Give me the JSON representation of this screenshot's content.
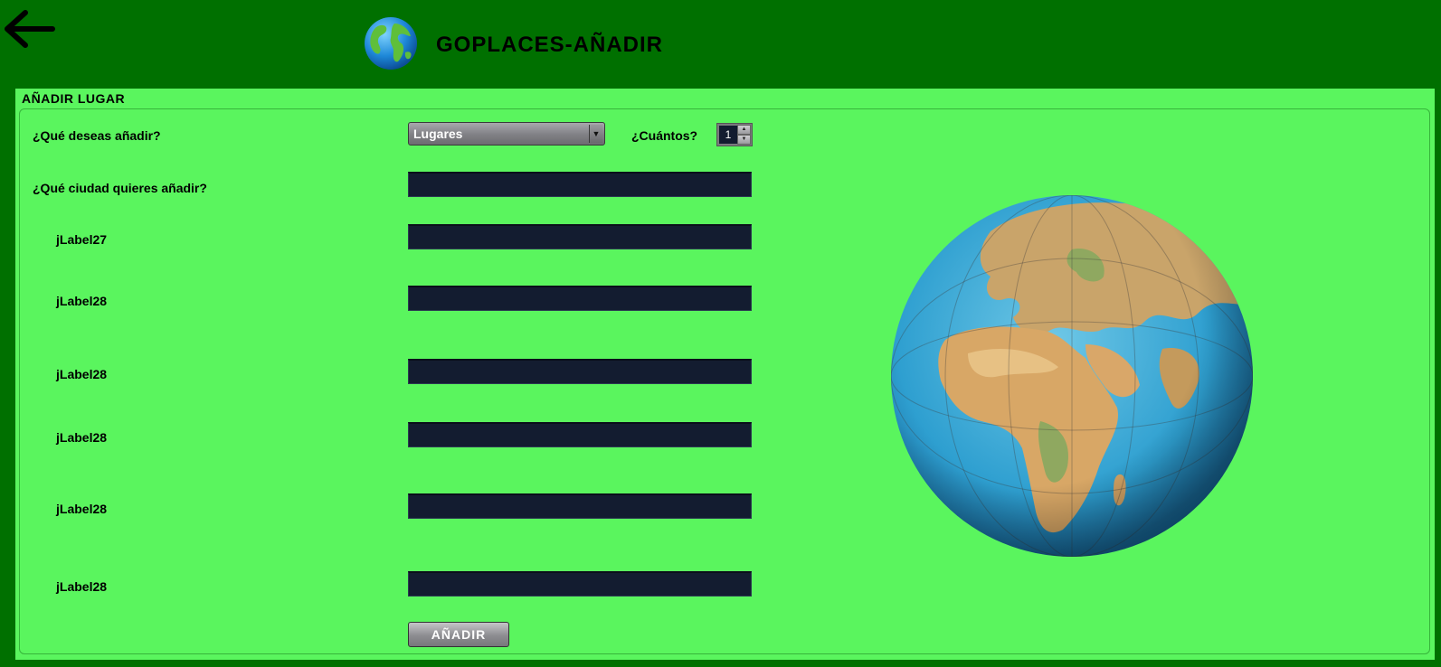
{
  "header": {
    "back_icon": "arrow-left-icon",
    "logo_icon": "globe-icon",
    "title": "GOPLACES-AÑADIR"
  },
  "panel": {
    "title": "AÑADIR LUGAR"
  },
  "form": {
    "what_label": "¿Qué deseas añadir?",
    "type_select": {
      "selected": "Lugares"
    },
    "count_label": "¿Cuántos?",
    "count_value": "1",
    "city_label": "¿Qué ciudad quieres añadir?",
    "city_value": "",
    "fields": [
      {
        "label": "jLabel27",
        "value": ""
      },
      {
        "label": "jLabel28",
        "value": ""
      },
      {
        "label": "jLabel28",
        "value": ""
      },
      {
        "label": "jLabel28",
        "value": ""
      },
      {
        "label": "jLabel28",
        "value": ""
      },
      {
        "label": "jLabel28",
        "value": ""
      }
    ],
    "submit_label": "AÑADIR"
  },
  "illustration": {
    "icon": "world-globe-image"
  },
  "colors": {
    "window_bg": "#007000",
    "panel_bg": "#5af55e",
    "field_bg": "#131c30"
  }
}
